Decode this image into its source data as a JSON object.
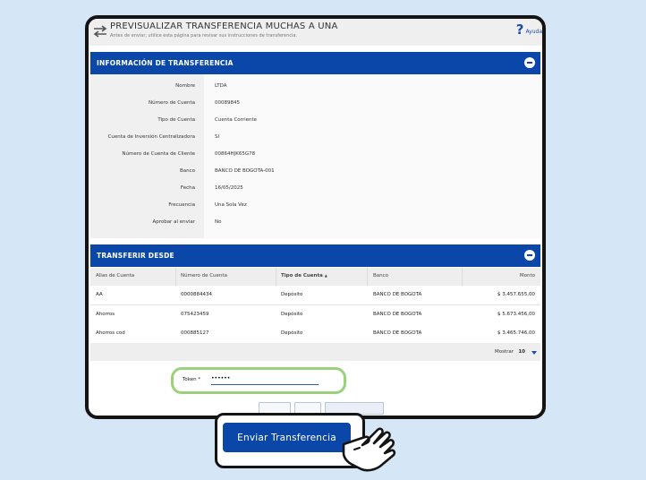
{
  "window": {
    "title": "PREVISUALIZAR TRANSFERENCIA MUCHAS A UNA",
    "subtitle": "Antes de enviar, utilice esta página para revisar sus instrucciones de transferencia.",
    "help_label": "Ayuda"
  },
  "info_section": {
    "title": "INFORMACIÓN DE TRANSFERENCIA",
    "rows": [
      {
        "label": "Nombre",
        "value": "LTDA"
      },
      {
        "label": "Número de Cuenta",
        "value": "00089845"
      },
      {
        "label": "Tipo de Cuenta",
        "value": "Cuenta Corriente"
      },
      {
        "label": "Cuenta de Inversión Centralizadora",
        "value": "SI"
      },
      {
        "label": "Número de Cuenta de Cliente",
        "value": "00864HJK65G78"
      },
      {
        "label": "Banco",
        "value": "BANCO DE BOGOTA-001"
      },
      {
        "label": "Fecha",
        "value": "16/05/2025"
      },
      {
        "label": "Frecuencia",
        "value": "Una Sola Vez"
      },
      {
        "label": "Aprobar al enviar",
        "value": "No"
      }
    ]
  },
  "transfer_from": {
    "title": "TRANSFERIR DESDE",
    "columns": [
      "Alias de Cuenta",
      "Número de Cuenta",
      "Tipo de Cuenta",
      "Banco",
      "Monto"
    ],
    "sort_indicator": "▲",
    "rows": [
      {
        "alias": "AA",
        "number": "0000884434",
        "type": "Depósito",
        "bank": "BANCO DE BOGOTA",
        "amount": "$ 3.457.655,00"
      },
      {
        "alias": "Ahorros",
        "number": "075423459",
        "type": "Depósito",
        "bank": "BANCO DE BOGOTA",
        "amount": "$ 5.673.456,00"
      },
      {
        "alias": "Ahorros cod",
        "number": "000885127",
        "type": "Depósito",
        "bank": "BANCO DE BOGOTA",
        "amount": "$ 3.465.746,00"
      }
    ],
    "pager_label": "Mostrar",
    "pager_value": "10"
  },
  "token": {
    "label": "Token *",
    "value": "••••••"
  },
  "cta": {
    "label": "Enviar Transferencia"
  },
  "colors": {
    "brand_blue": "#0b47a8",
    "highlight_green": "#9ad17a",
    "background": "#d5e6f7"
  }
}
